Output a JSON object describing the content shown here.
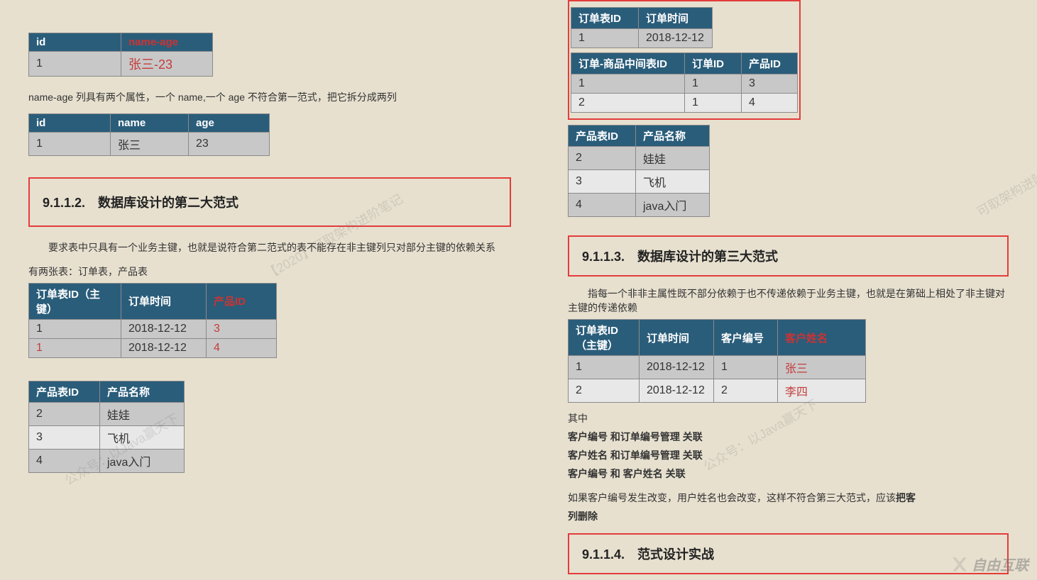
{
  "left": {
    "table1": {
      "headers": [
        "id",
        "name-age"
      ],
      "row": [
        "1",
        "张三-23"
      ]
    },
    "para1": "name-age 列具有两个属性，一个 name,一个 age 不符合第一范式，把它拆分成两列",
    "table2": {
      "headers": [
        "id",
        "name",
        "age"
      ],
      "row": [
        "1",
        "张三",
        "23"
      ]
    },
    "heading1": "9.1.1.2.　数据库设计的第二大范式",
    "para2": "要求表中只具有一个业务主键，也就是说符合第二范式的表不能存在非主键列只对部分主键的依赖关系",
    "para3": "有两张表：订单表，产品表",
    "table3": {
      "headers": [
        "订单表ID（主键）",
        "订单时间",
        "产品ID"
      ],
      "rows": [
        [
          "1",
          "2018-12-12",
          "3"
        ],
        [
          "1",
          "2018-12-12",
          "4"
        ]
      ]
    },
    "table4": {
      "headers": [
        "产品表ID",
        "产品名称"
      ],
      "rows": [
        [
          "2",
          "娃娃"
        ],
        [
          "3",
          "飞机"
        ],
        [
          "4",
          "java入门"
        ]
      ]
    }
  },
  "right": {
    "tableA": {
      "headers": [
        "订单表ID",
        "订单时间"
      ],
      "row": [
        "1",
        "2018-12-12"
      ]
    },
    "tableB": {
      "headers": [
        "订单-商品中间表ID",
        "订单ID",
        "产品ID"
      ],
      "rows": [
        [
          "1",
          "1",
          "3"
        ],
        [
          "2",
          "1",
          "4"
        ]
      ]
    },
    "tableC": {
      "headers": [
        "产品表ID",
        "产品名称"
      ],
      "rows": [
        [
          "2",
          "娃娃"
        ],
        [
          "3",
          "飞机"
        ],
        [
          "4",
          "java入门"
        ]
      ]
    },
    "heading2": "9.1.1.3.　数据库设计的第三大范式",
    "para4": "指每一个非非主属性既不部分依赖于也不传递依赖于业务主键，也就是在第础上相处了非主键对主键的传递依赖",
    "tableD": {
      "headers": [
        "订单表ID（主键）",
        "订单时间",
        "客户编号",
        "客户姓名"
      ],
      "rows": [
        [
          "1",
          "2018-12-12",
          "1",
          "张三"
        ],
        [
          "2",
          "2018-12-12",
          "2",
          "李四"
        ]
      ]
    },
    "para5": "其中",
    "para6": "客户编号 和订单编号管理 关联",
    "para7": "客户姓名 和订单编号管理 关联",
    "para8": "客户编号 和 客户姓名 关联",
    "para9a": "如果客户编号发生改变，用户姓名也会改变，这样不符合第三大范式，应该",
    "para9b": "把客",
    "para10": "列删除",
    "heading3": "9.1.1.4.　范式设计实战"
  },
  "watermarks": {
    "w1": "【2020】可取架构进阶笔记",
    "w2": "公众号：以Java赢天下",
    "w3": "可取架构进阶",
    "w4": "公众号：以Java赢天下"
  },
  "logo": "自由互联"
}
